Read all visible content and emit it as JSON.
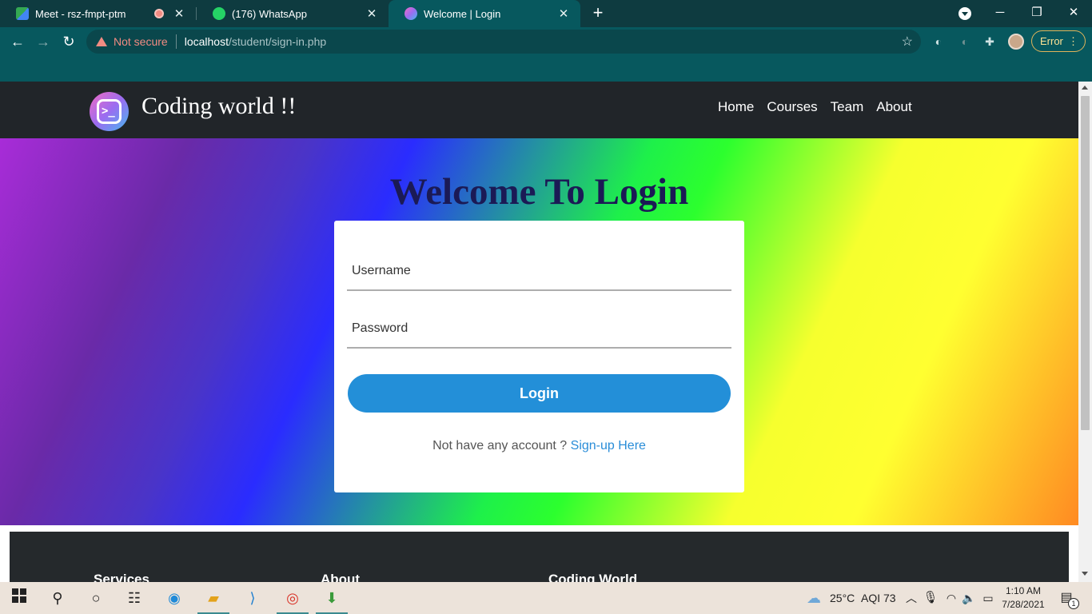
{
  "browser": {
    "tabs": [
      {
        "title": "Meet - rsz-fmpt-ptm",
        "icon": "google-meet-icon",
        "recording": true
      },
      {
        "title": "(176) WhatsApp",
        "icon": "whatsapp-icon"
      },
      {
        "title": "Welcome | Login",
        "icon": "coding-world-icon",
        "active": true
      }
    ],
    "security_label": "Not secure",
    "url_host": "localhost",
    "url_path": "/student/sign-in.php",
    "profile_status": "Error"
  },
  "site": {
    "brand": "Coding world !!",
    "logo_glyph": ">_",
    "nav": [
      "Home",
      "Courses",
      "Team",
      "About"
    ]
  },
  "login": {
    "heading": "Welcome To Login",
    "username_placeholder": "Username",
    "password_placeholder": "Password",
    "button_label": "Login",
    "signup_prompt": "Not have any account ?",
    "signup_link": "Sign-up Here"
  },
  "footer": {
    "columns": [
      "Services",
      "About",
      "Coding World"
    ]
  },
  "taskbar": {
    "weather": "25°C",
    "aqi": "AQI 73",
    "time": "1:10 AM",
    "date": "7/28/2021",
    "notification_count": "1"
  },
  "colors": {
    "nav_bg": "#212529",
    "button": "#238fd8",
    "heading": "#1b1a55",
    "link": "#2a8dd8"
  }
}
